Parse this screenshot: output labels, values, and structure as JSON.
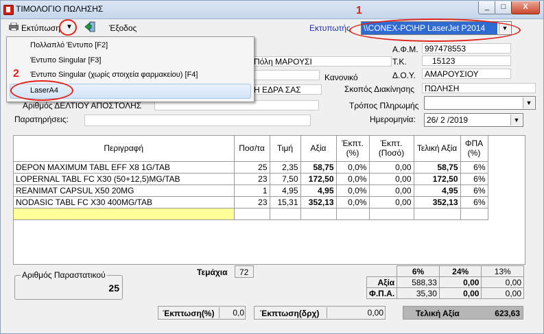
{
  "window": {
    "title": "ΤΙΜΟΛΟΓΙΟ ΠΩΛΗΣΗΣ",
    "min": "_",
    "max": "□",
    "close": "X"
  },
  "toolbar": {
    "print_label": "Εκτύπωση",
    "exit_label": "Έξοδος",
    "printer_label": "Εκτυπωτής",
    "printer_value": "\\\\CONEX-PC\\HP LaserJet P2014"
  },
  "annotations": {
    "one": "1",
    "two": "2"
  },
  "menu": {
    "items": [
      "Πολλαπλό Έντυπο [F2]",
      "Έντυπο Singular [F3]",
      "Έντυπο Singular (χωρίς στοιχεία φαρμακείου) [F4]",
      "LaserA4"
    ]
  },
  "form": {
    "city_value": "Πόλη ΜΑΡΟΥΣΙ",
    "afm_label": "Α.Φ.Μ.",
    "afm_value": "997478553",
    "tk_label": "Τ.Κ.",
    "tk_value": "15123",
    "kanoniko_label": "Κανονικό",
    "doy_label": "Δ.Ο.Υ.",
    "doy_value": "ΑΜΑΡΟΥΣΙΟΥ",
    "edra_value": "Η ΕΔΡΑ ΣΑΣ",
    "skopos_label": "Σκοπός Διακίνησης",
    "skopos_value": "ΠΩΛΗΣΗ",
    "deltio_label": "Αριθμός ΔΕΛΤΙΟΥ ΑΠΟΣΤΟΛΗΣ",
    "tropos_label": "Τρόπος Πληρωμής",
    "notes_label": "Παρατηρήσεις:",
    "date_label": "Ημερομηνία:",
    "date_value": "26/ 2 /2019"
  },
  "grid": {
    "headers": [
      "Περιγραφή",
      "Ποσ/τα",
      "Τιμή",
      "Αξία",
      "Έκπτ.\n(%)",
      "Έκπτ.\n(Ποσό)",
      "Τελική Αξία",
      "ΦΠΑ\n(%)"
    ],
    "rows": [
      [
        "DEPON MAXIMUM TABL EFF X8 1G/TAB",
        "25",
        "2,35",
        "58,75",
        "0,0%",
        "0,00",
        "58,75",
        "6%"
      ],
      [
        "LOPERNAL TABL FC X30 (50+12,5)MG/TAB",
        "23",
        "7,50",
        "172,50",
        "0,0%",
        "0,00",
        "172,50",
        "6%"
      ],
      [
        "REANIMAT CAPSUL X50 20MG",
        "1",
        "4,95",
        "4,95",
        "0,0%",
        "0,00",
        "4,95",
        "6%"
      ],
      [
        "NODASIC TABL FC X30 400MG/TAB",
        "23",
        "15,31",
        "352,13",
        "0,0%",
        "0,00",
        "352,13",
        "6%"
      ]
    ]
  },
  "summary": {
    "temaxia_label": "Τεμάχια",
    "temaxia_value": "72",
    "parastatiko_label": "Αριθμός Παραστατικού",
    "parastatiko_value": "25",
    "vat_headers": [
      "6%",
      "24%",
      "13%"
    ],
    "axia_label": "Αξία",
    "axia_values": [
      "588,33",
      "0,00",
      "0,00"
    ],
    "fpa_label": "Φ.Π.Α.",
    "fpa_values": [
      "35,30",
      "0,00",
      "0,00"
    ],
    "ekptosi_pct_label": "Έκπτωση(%)",
    "ekptosi_pct_value": "0,0",
    "ekptosi_drx_label": "Έκπτωση(δρχ)",
    "ekptosi_drx_value": "0,00",
    "teliki_label": "Τελική Αξία",
    "teliki_value": "623,63"
  }
}
